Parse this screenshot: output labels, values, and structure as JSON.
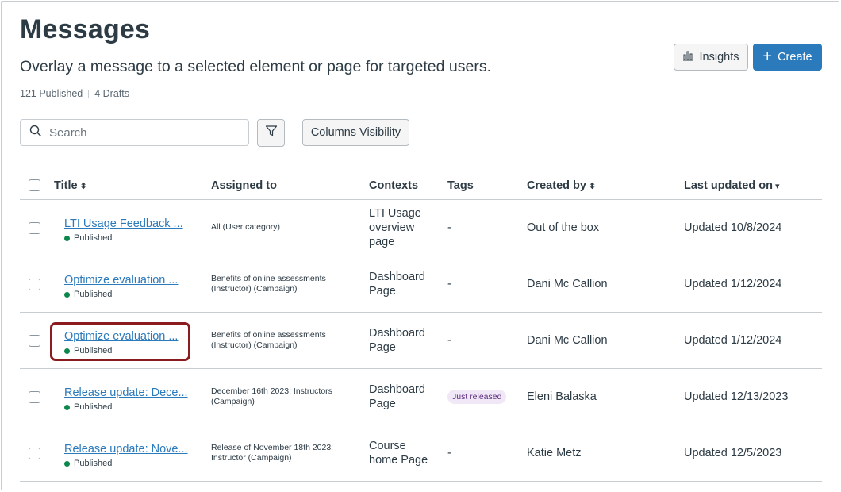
{
  "header": {
    "title": "Messages",
    "subtitle": "Overlay a message to a selected element or page for targeted users.",
    "published_count": "121 Published",
    "drafts_count": "4 Drafts",
    "insights_label": "Insights",
    "create_label": "Create"
  },
  "toolbar": {
    "search_placeholder": "Search",
    "columns_label": "Columns Visibility"
  },
  "table": {
    "columns": {
      "title": "Title",
      "assigned": "Assigned to",
      "contexts": "Contexts",
      "tags": "Tags",
      "created": "Created by",
      "updated": "Last updated on"
    },
    "sort_both_icon": "⬍",
    "sort_down_icon": "▾",
    "rows": [
      {
        "title": "LTI Usage Feedback ...",
        "status": "Published",
        "assigned_lines": [
          "All (User category)"
        ],
        "context_lines": [
          "LTI Usage",
          "overview",
          "page"
        ],
        "tag": "-",
        "created_by": "Out of the box",
        "updated": "Updated 10/8/2024"
      },
      {
        "title": "Optimize evaluation ...",
        "status": "Published",
        "assigned_lines": [
          "Benefits of online assessments",
          "(Instructor) (Campaign)"
        ],
        "context_lines": [
          "Dashboard",
          "Page"
        ],
        "tag": "-",
        "created_by": "Dani Mc Callion",
        "updated": "Updated 1/12/2024"
      },
      {
        "title": "Optimize evaluation ...",
        "status": "Published",
        "assigned_lines": [
          "Benefits of online assessments",
          "(Instructor) (Campaign)"
        ],
        "context_lines": [
          "Dashboard",
          "Page"
        ],
        "tag": "-",
        "created_by": "Dani Mc Callion",
        "updated": "Updated 1/12/2024"
      },
      {
        "title": "Release update: Dece...",
        "status": "Published",
        "assigned_lines": [
          "December 16th 2023: Instructors",
          "(Campaign)"
        ],
        "context_lines": [
          "Dashboard",
          "Page"
        ],
        "tag": "Just released",
        "created_by": "Eleni Balaska",
        "updated": "Updated 12/13/2023"
      },
      {
        "title": "Release update: Nove...",
        "status": "Published",
        "assigned_lines": [
          "Release of November 18th 2023:",
          "Instructor (Campaign)"
        ],
        "context_lines": [
          "Course",
          "home Page"
        ],
        "tag": "-",
        "created_by": "Katie Metz",
        "updated": "Updated 12/5/2023"
      }
    ]
  },
  "colors": {
    "primary": "#2b7abc",
    "published_dot": "#0b874b",
    "highlight_border": "#8a1c1f",
    "tag_bg": "#f1e8f7"
  }
}
